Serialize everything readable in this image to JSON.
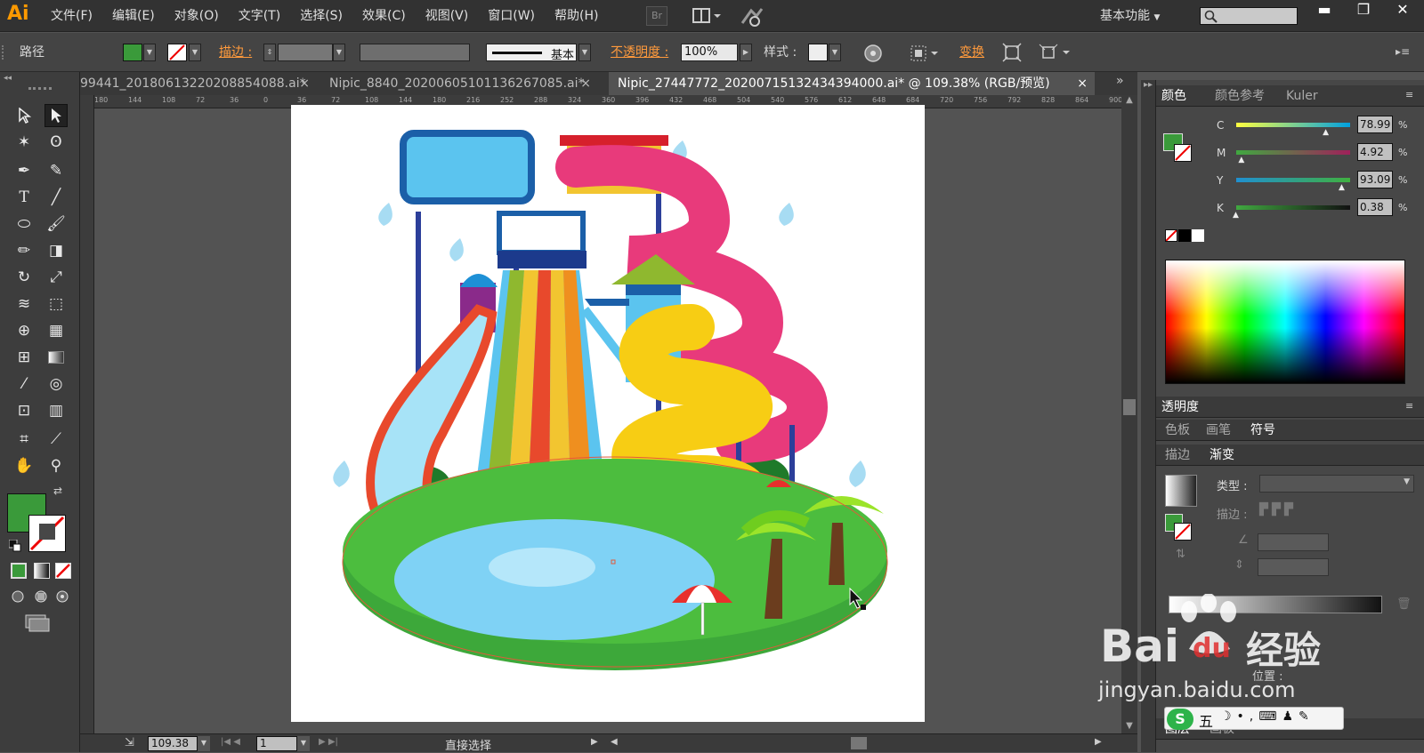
{
  "app": {
    "logo": "Ai"
  },
  "menu": [
    "文件(F)",
    "编辑(E)",
    "对象(O)",
    "文字(T)",
    "选择(S)",
    "效果(C)",
    "视图(V)",
    "窗口(W)",
    "帮助(H)"
  ],
  "menubar": {
    "bridge_label": "Br",
    "workspace": "基本功能",
    "minimize": "▬",
    "restore": "❐",
    "close": "✕"
  },
  "control_bar": {
    "object_type": "路径",
    "stroke_label": "描边 :",
    "stroke_style": "基本",
    "opacity_label": "不透明度 :",
    "opacity_value": "100%",
    "style_label": "样式 :",
    "transform_label": "变换",
    "fill_color": "#3a9a3a"
  },
  "tabs": [
    {
      "label": "99441_20180613220208854088.ai*",
      "close": "×"
    },
    {
      "label": "Nipic_8840_20200605101136267085.ai*",
      "close": "×"
    },
    {
      "label": "Nipic_27447772_20200715132434394000.ai* @ 109.38% (RGB/预览)",
      "close": "×",
      "active": true
    }
  ],
  "ruler_ticks": [
    "180",
    "144",
    "108",
    "72",
    "36",
    "0",
    "36",
    "72",
    "108",
    "144",
    "180",
    "216",
    "252",
    "288",
    "324",
    "360",
    "396",
    "432",
    "468",
    "504",
    "540",
    "576",
    "612",
    "648",
    "684",
    "720",
    "756",
    "792",
    "828",
    "864",
    "900"
  ],
  "status": {
    "zoom": "109.38",
    "artboard": "1",
    "tool_name": "直接选择"
  },
  "panels": {
    "color": {
      "tabs": [
        "颜色",
        "颜色参考",
        "Kuler"
      ],
      "sliders": [
        {
          "label": "C",
          "value": "78.99",
          "pct": "%",
          "fraction": 0.79
        },
        {
          "label": "M",
          "value": "4.92",
          "pct": "%",
          "fraction": 0.05
        },
        {
          "label": "Y",
          "value": "93.09",
          "pct": "%",
          "fraction": 0.93
        },
        {
          "label": "K",
          "value": "0.38",
          "pct": "%",
          "fraction": 0.0
        }
      ]
    },
    "transparency": {
      "title": "透明度"
    },
    "swatch_tabs": [
      "色板",
      "画笔",
      "符号"
    ],
    "gradient": {
      "tabs": [
        "描边",
        "渐变"
      ],
      "type_label": "类型 :",
      "stroke_label": "描边 :",
      "location_label": "位置 :"
    },
    "bottom_tabs": [
      "图层",
      "画板"
    ]
  },
  "watermark": {
    "brand": "Bai",
    "brand2": "du",
    "brand3": "经验",
    "url": "jingyan.baidu.com"
  },
  "ime": {
    "label": "五"
  },
  "colors": {
    "accent_orange": "#ff9a3c",
    "fill_green": "#3a9a3a"
  }
}
